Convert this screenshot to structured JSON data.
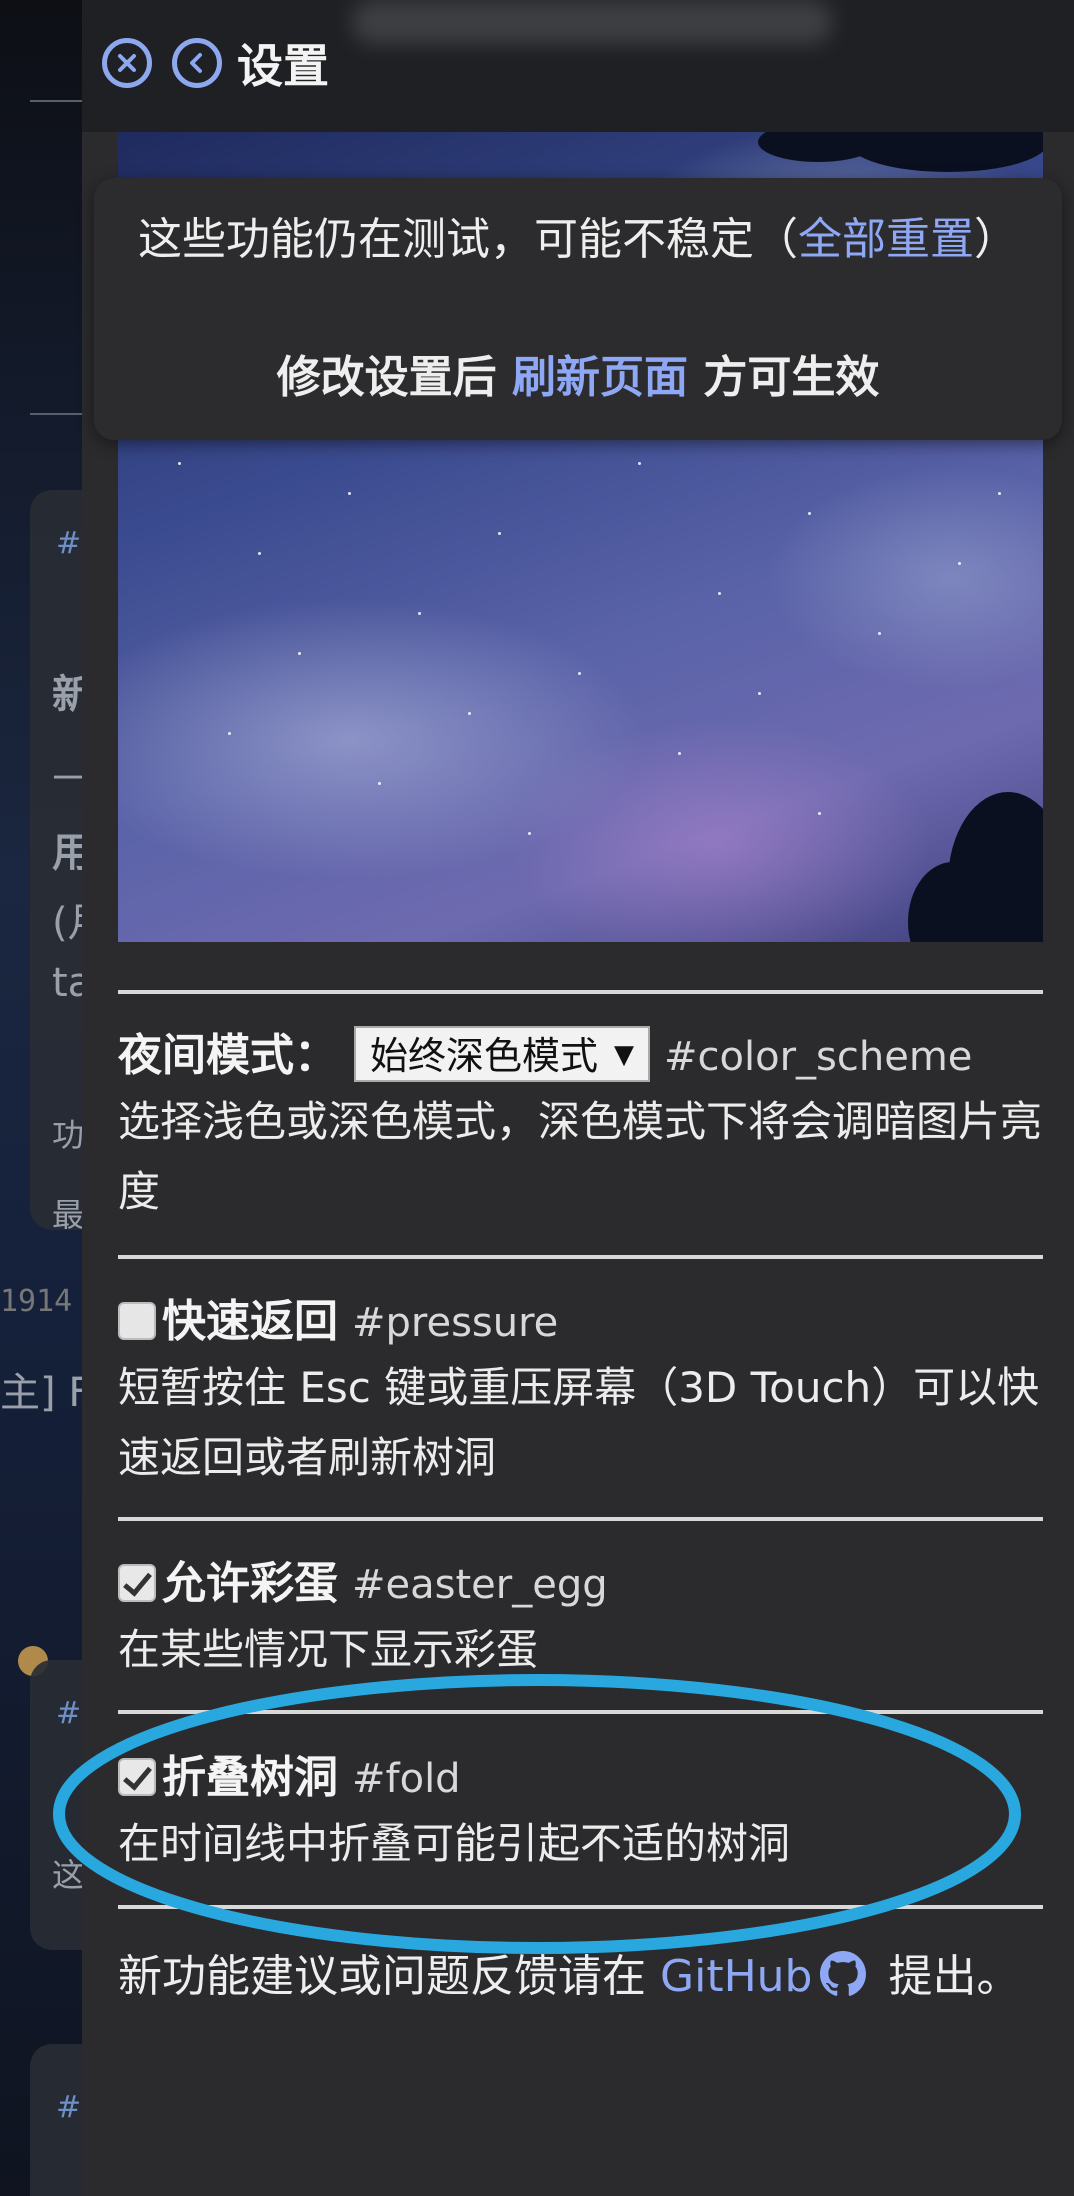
{
  "header": {
    "title": "设置",
    "close_icon": "close-circle-icon",
    "back_icon": "back-circle-icon",
    "accent_color": "#8ea8f0"
  },
  "notice": {
    "text_before_link": "这些功能仍在测试，可能不稳定（",
    "reset_link": "全部重置",
    "text_after_link": "）",
    "line2_before": "修改设置后 ",
    "refresh_link": "刷新页面",
    "line2_after": " 方可生效"
  },
  "settings": [
    {
      "label": "夜间模式：",
      "select_value": "始终深色模式",
      "code": "#color_scheme",
      "description": "选择浅色或深色模式，深色模式下将会调暗图片亮度"
    },
    {
      "label": "快速返回",
      "checked": false,
      "code": "#pressure",
      "description": "短暂按住 Esc 键或重压屏幕（3D Touch）可以快速返回或者刷新树洞"
    },
    {
      "label": "允许彩蛋",
      "checked": true,
      "code": "#easter_egg",
      "description": "在某些情况下显示彩蛋"
    },
    {
      "label": "折叠树洞",
      "checked": true,
      "code": "#fold",
      "description": "在时间线中折叠可能引起不适的树洞"
    }
  ],
  "footer": {
    "text_before": "新功能建议或问题反馈请在 ",
    "github_link": "GitHub",
    "github_icon": "github-icon",
    "text_after": " 提出。"
  },
  "highlight_color": "#29a8e0",
  "background": {
    "fragments": [
      "#",
      "新",
      "—",
      "用",
      "(月",
      "ta",
      "功",
      "最",
      "1914",
      "主] F",
      "#",
      "这",
      "#"
    ]
  }
}
